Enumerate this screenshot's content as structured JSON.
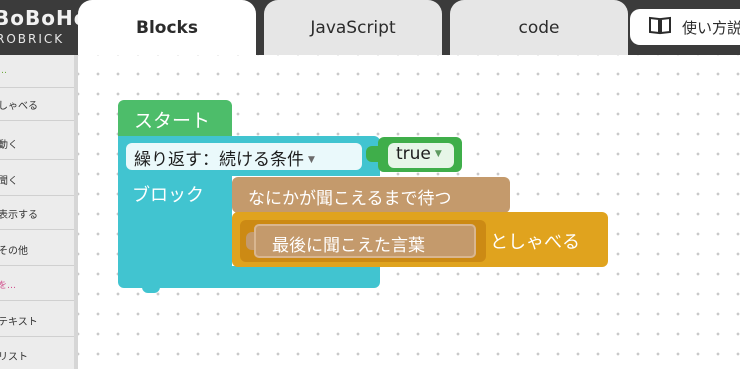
{
  "brand": {
    "logo": "BoBoHo",
    "subtitle": "ROBRICK"
  },
  "tabs": [
    {
      "label": "Blocks",
      "active": true
    },
    {
      "label": "JavaScript",
      "active": false
    },
    {
      "label": "code",
      "active": false
    }
  ],
  "help_button": {
    "label": "使い方説",
    "icon": "book-icon"
  },
  "sidebar": {
    "items": [
      {
        "label": "…",
        "color": "#6aa83a"
      },
      {
        "label": "しゃべる"
      },
      {
        "label": "動く"
      },
      {
        "label": "聞く"
      },
      {
        "label": "表示する"
      },
      {
        "label": "その他"
      },
      {
        "label": "を…",
        "color": "#d04b8a"
      },
      {
        "label": "テキスト"
      },
      {
        "label": "リスト"
      }
    ]
  },
  "blocks": {
    "start_label": "スタート",
    "loop_dropdown": "繰り返す：続ける条件",
    "loop_condition": "true",
    "loop_body_label": "ブロック",
    "wait_label": "なにかが聞こえるまで待つ",
    "say_input": "最後に聞こえた言葉",
    "say_label": "としゃべる"
  },
  "colors": {
    "start": "#4dbd6a",
    "loop": "#41c4d0",
    "logic": "#3fae4a",
    "sound": "#c49a6c",
    "speech": "#e0a31e",
    "header": "#3b3b3b"
  }
}
